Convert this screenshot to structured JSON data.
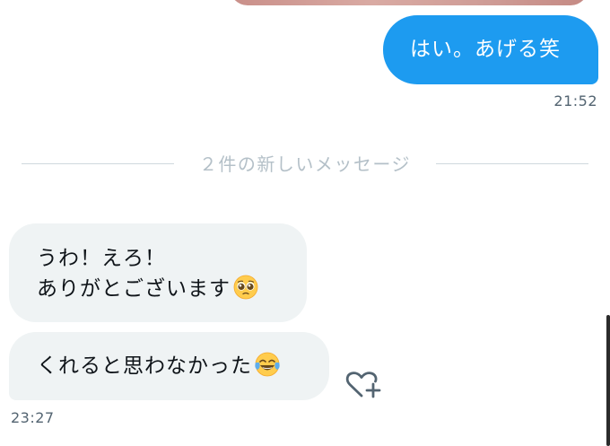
{
  "messages": {
    "outgoing": {
      "text": "はい。あげる笑",
      "time": "21:52"
    },
    "new_divider": "２件の新しいメッセージ",
    "incoming": [
      {
        "line1": "うわ！えろ！",
        "line2": "ありがとございます",
        "emoji": "pleading-face-icon"
      },
      {
        "text": "くれると思わなかった",
        "emoji": "tears-of-joy-icon"
      }
    ],
    "incoming_time": "23:27"
  },
  "icons": {
    "react": "heart-plus-icon"
  },
  "colors": {
    "outgoing_bubble": "#1d9bf0",
    "incoming_bubble": "#eff3f4",
    "timestamp": "#536471",
    "divider_text": "#b4c0c8"
  }
}
